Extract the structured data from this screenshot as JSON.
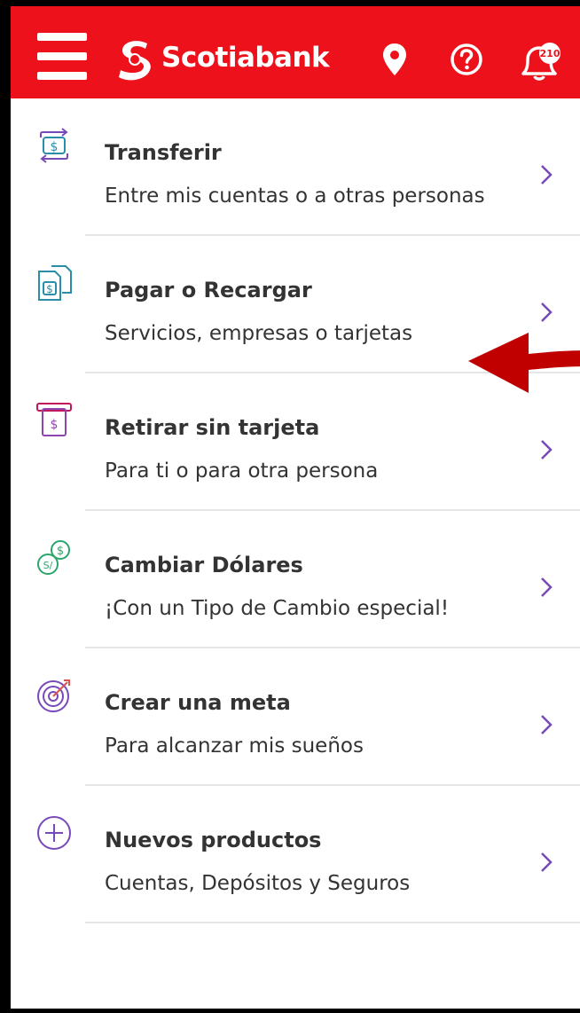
{
  "header": {
    "brand_name": "Scotiabank",
    "menu_icon": "hamburger-menu-icon",
    "location_icon": "location-pin-icon",
    "help_icon": "help-circle-icon",
    "notifications_icon": "bell-icon",
    "notifications_badge": "210",
    "colors": {
      "bar": "#ec111a",
      "icon": "#ffffff"
    }
  },
  "menu": {
    "items": [
      {
        "title": "Transferir",
        "subtitle": "Entre mis cuentas o a otras personas",
        "icon": "transfer-icon"
      },
      {
        "title": "Pagar o Recargar",
        "subtitle": "Servicios, empresas o tarjetas",
        "icon": "pay-bill-icon"
      },
      {
        "title": "Retirar sin tarjeta",
        "subtitle": "Para ti o para otra persona",
        "icon": "cardless-withdraw-icon"
      },
      {
        "title": "Cambiar Dólares",
        "subtitle": "¡Con un Tipo de Cambio especial!",
        "icon": "currency-exchange-icon"
      },
      {
        "title": "Crear una meta",
        "subtitle": "Para alcanzar mis sueños",
        "icon": "goal-target-icon"
      },
      {
        "title": "Nuevos productos",
        "subtitle": "Cuentas, Depósitos y Seguros",
        "icon": "plus-circle-icon"
      }
    ],
    "chevron_color": "#7849b8"
  },
  "annotation": {
    "type": "red-arrow",
    "color": "#c00000",
    "points_to": "Pagar o Recargar"
  }
}
